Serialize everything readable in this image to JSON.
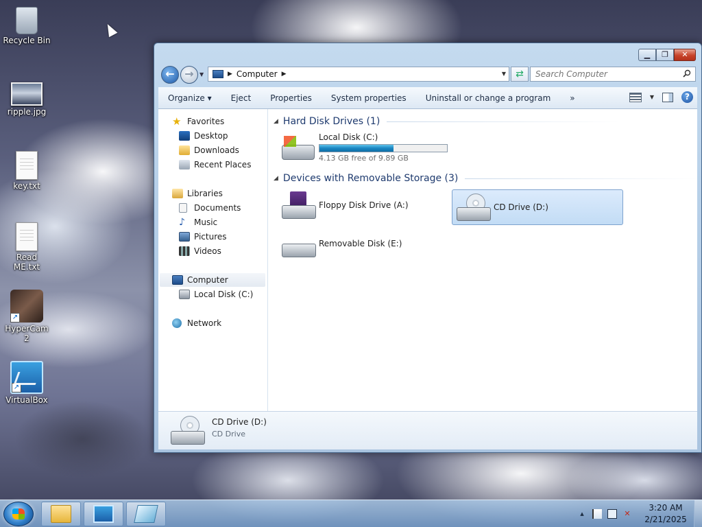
{
  "desktop": {
    "icons": [
      {
        "label": "Recycle Bin",
        "icon": "recycle-bin-icon"
      },
      {
        "label": "ripple.jpg",
        "icon": "image-file-icon"
      },
      {
        "label": "key.txt",
        "icon": "text-file-icon"
      },
      {
        "label": "Read ME.txt",
        "icon": "text-file-icon"
      },
      {
        "label": "HyperCam 2",
        "icon": "camera-app-icon"
      },
      {
        "label": "VirtualBox",
        "icon": "virtualbox-icon"
      }
    ]
  },
  "window": {
    "caption_buttons": {
      "minimize": "▁",
      "maximize": "❐",
      "close": "✕"
    },
    "nav": {
      "back": "←",
      "forward": "→"
    },
    "address": {
      "crumbs": [
        "Computer"
      ]
    },
    "search": {
      "placeholder": "Search Computer"
    },
    "toolbar": {
      "organize": "Organize ▾",
      "eject": "Eject",
      "properties": "Properties",
      "system_properties": "System properties",
      "uninstall": "Uninstall or change a program",
      "more": "»",
      "help": "?"
    },
    "nav_pane": {
      "favorites": "Favorites",
      "desktop": "Desktop",
      "downloads": "Downloads",
      "recent_places": "Recent Places",
      "libraries": "Libraries",
      "documents": "Documents",
      "music": "Music",
      "pictures": "Pictures",
      "videos": "Videos",
      "computer": "Computer",
      "local_disk": "Local Disk (C:)",
      "network": "Network"
    },
    "groups": {
      "hdd": {
        "header": "Hard Disk Drives (1)",
        "drives": [
          {
            "name": "Local Disk (C:)",
            "free": "4.13 GB free of 9.89 GB",
            "used_fraction": 0.58
          }
        ]
      },
      "removable": {
        "header": "Devices with Removable Storage (3)",
        "drives": [
          {
            "name": "Floppy Disk Drive (A:)"
          },
          {
            "name": "CD Drive (D:)"
          },
          {
            "name": "Removable Disk (E:)"
          }
        ]
      }
    },
    "details": {
      "title": "CD Drive (D:)",
      "subtitle": "CD Drive"
    }
  },
  "taskbar": {
    "clock_time": "3:20 AM",
    "clock_date": "2/21/2025",
    "tray_up": "▴"
  },
  "colors": {
    "accent": "#1e3a6e",
    "selection": "#c2dcf5",
    "usage_bar": "#1a86c2"
  }
}
